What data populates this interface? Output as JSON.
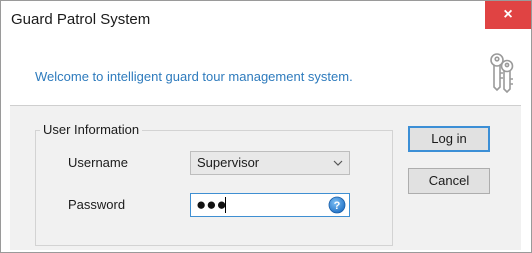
{
  "window": {
    "title": "Guard Patrol System",
    "close_glyph": "×"
  },
  "banner": {
    "welcome_text": "Welcome to intelligent guard tour management system.",
    "icon": "keys-icon"
  },
  "login_form": {
    "group_title": "User Information",
    "username_label": "Username",
    "username_value": "Supervisor",
    "password_label": "Password",
    "password_mask": "●●●",
    "help_icon": "help-icon",
    "dropdown_icon": "chevron-down-icon"
  },
  "buttons": {
    "login_label": "Log in",
    "cancel_label": "Cancel"
  },
  "colors": {
    "accent_text": "#2e7bbd",
    "close_button": "#e04343",
    "focus_border": "#3f8fd2"
  }
}
